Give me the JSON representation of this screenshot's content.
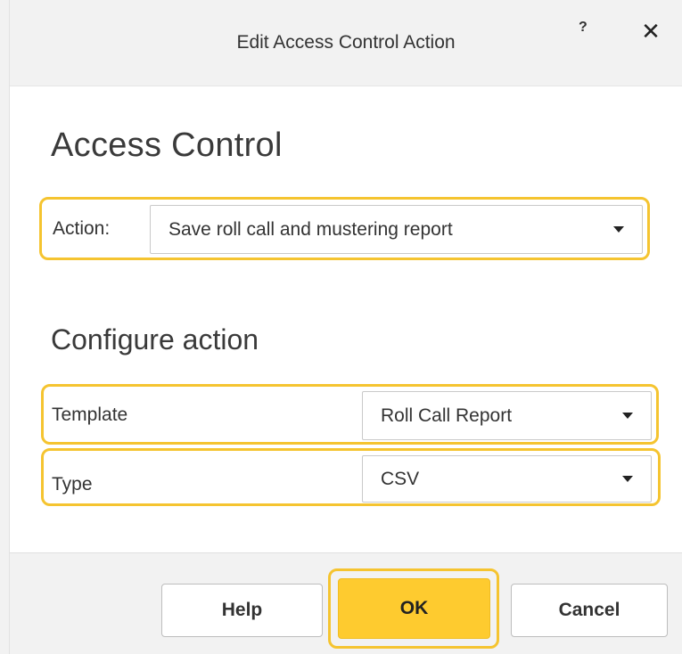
{
  "dialog": {
    "title": "Edit Access Control Action",
    "help_glyph": "?",
    "close_glyph": "✕"
  },
  "main": {
    "heading": "Access Control",
    "action": {
      "label": "Action:",
      "value": "Save roll call and mustering report"
    }
  },
  "configure": {
    "heading": "Configure action",
    "template": {
      "label": "Template",
      "value": "Roll Call Report"
    },
    "type": {
      "label": "Type",
      "value": "CSV"
    }
  },
  "footer": {
    "help_label": "Help",
    "ok_label": "OK",
    "cancel_label": "Cancel"
  },
  "colors": {
    "highlight": "#f5c430",
    "primary_button": "#fecb2f",
    "chrome": "#f2f2f2"
  },
  "icons": {
    "help": "question-icon",
    "close": "close-icon",
    "dropdown": "chevron-down-icon"
  }
}
